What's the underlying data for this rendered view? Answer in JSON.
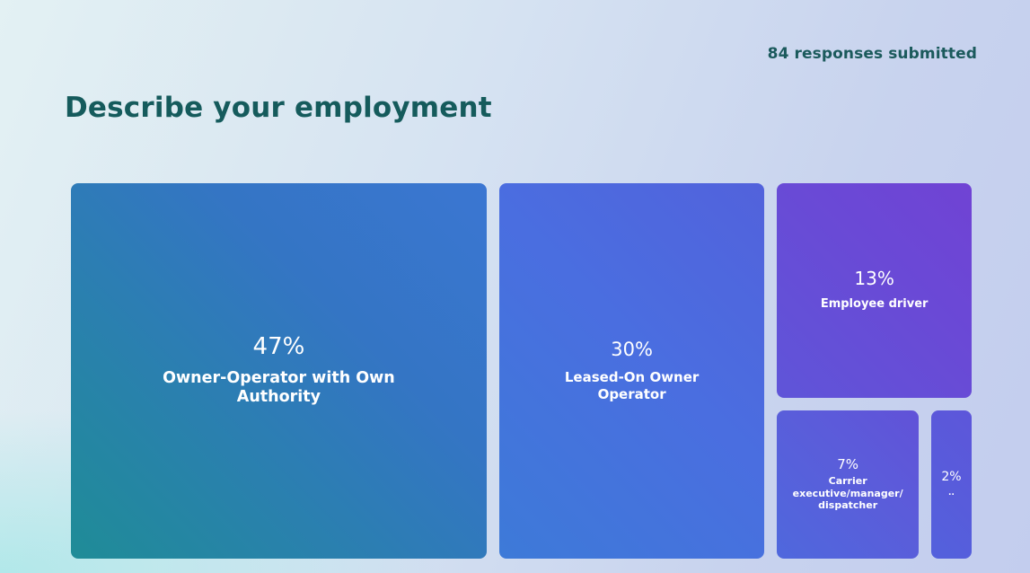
{
  "header": {
    "responses_label": "84 responses submitted"
  },
  "chart_data": {
    "type": "treemap",
    "title": "Describe your employment",
    "unit": "%",
    "items": [
      {
        "label": "Owner-Operator with Own Authority",
        "value": 47,
        "display": "47%"
      },
      {
        "label": "Leased-On Owner Operator",
        "value": 30,
        "display": "30%"
      },
      {
        "label": "Employee driver",
        "value": 13,
        "display": "13%"
      },
      {
        "label": "Carrier executive/manager/ dispatcher",
        "value": 7,
        "display": "7%"
      },
      {
        "label": "..",
        "value": 2,
        "display": "2%"
      }
    ]
  }
}
